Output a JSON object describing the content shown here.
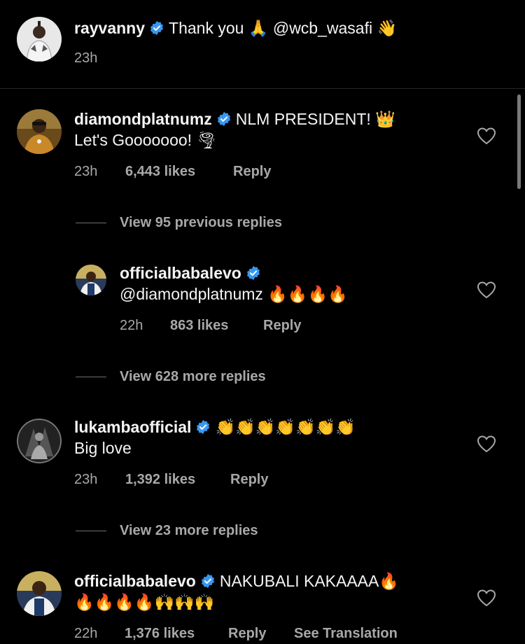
{
  "caption": {
    "username": "rayvanny",
    "text": "Thank you ",
    "emoji1": "🙏",
    "mention": "@wcb_wasafi",
    "emoji2": "👋",
    "time": "23h"
  },
  "comments": [
    {
      "username": "diamondplatnumz",
      "text_line1": "NLM PRESIDENT! ",
      "emoji_line1": "👑",
      "text_line2": "Let's Gooooooo! ",
      "emoji_line2": "🌪",
      "time": "23h",
      "likes": "6,443 likes",
      "reply": "Reply",
      "view_prev": "View 95 previous replies"
    },
    {
      "username": "officialbabalevo",
      "text_line1": "@diamondplatnumz ",
      "emoji_line1": "🔥🔥🔥🔥",
      "time": "22h",
      "likes": "863 likes",
      "reply": "Reply",
      "view_more": "View 628 more replies"
    },
    {
      "username": "lukambaofficial",
      "emoji_line1": "👏👏👏👏👏👏👏",
      "text_line2": "Big love",
      "time": "23h",
      "likes": "1,392 likes",
      "reply": "Reply",
      "view_more": "View 23 more replies"
    },
    {
      "username": "officialbabalevo",
      "text_line1": "NAKUBALI KAKAAAA",
      "emoji_line1": "🔥",
      "emoji_line2": "🔥🔥🔥🔥🙌🙌🙌",
      "time": "22h",
      "likes": "1,376 likes",
      "reply": "Reply",
      "see_translation": "See Translation"
    }
  ],
  "icons": {
    "verified": "verified-badge-icon",
    "heart": "heart-outline-icon"
  },
  "colors": {
    "background": "#000000",
    "verified": "#3897f0",
    "meta": "#a8a8a8"
  }
}
